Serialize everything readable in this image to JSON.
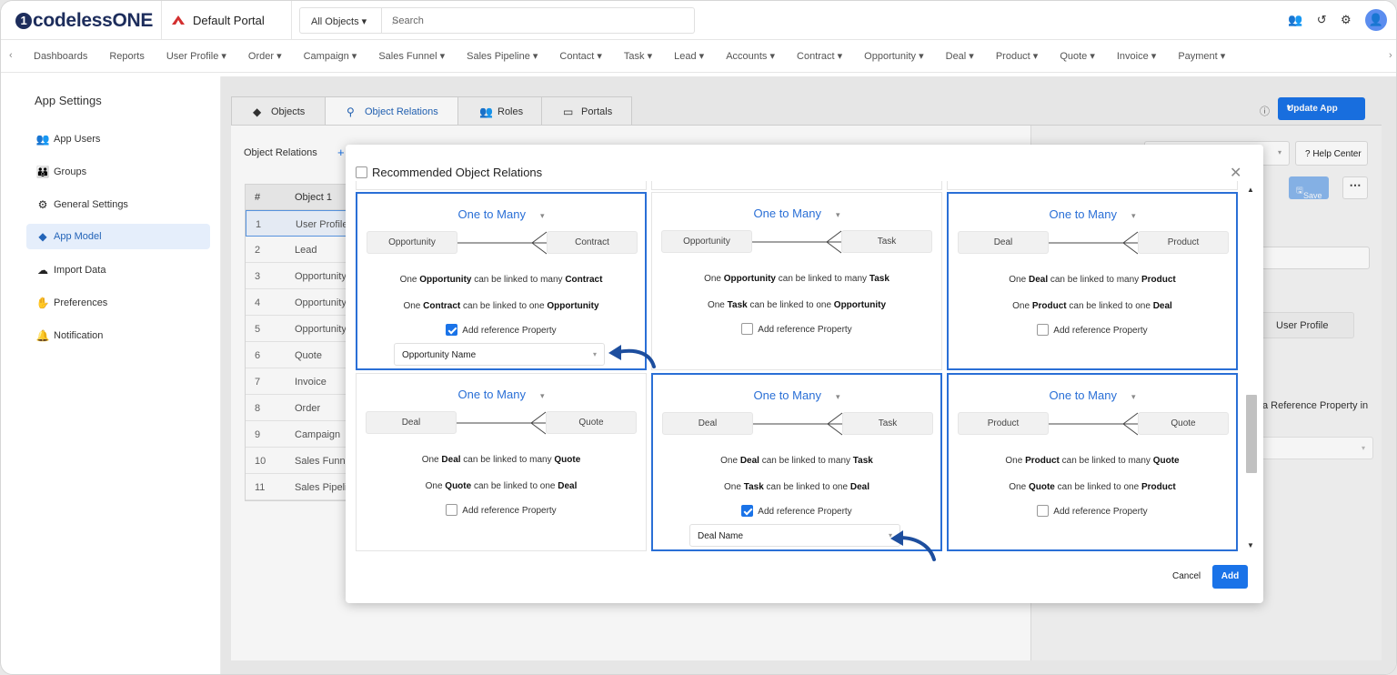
{
  "brand": {
    "logo_prefix": "1",
    "logo_main": "codeless",
    "logo_suffix": "ONE"
  },
  "header": {
    "portal_name": "Default Portal",
    "object_select": "All Objects",
    "search_placeholder": "Search"
  },
  "nav": {
    "items": [
      "Dashboards",
      "Reports",
      "User Profile ▾",
      "Order ▾",
      "Campaign ▾",
      "Sales Funnel ▾",
      "Sales Pipeline ▾",
      "Contact ▾",
      "Task ▾",
      "Lead ▾",
      "Accounts ▾",
      "Contract ▾",
      "Opportunity ▾",
      "Deal ▾",
      "Product ▾",
      "Quote ▾",
      "Invoice ▾",
      "Payment ▾"
    ]
  },
  "sidebar": {
    "title": "App Settings",
    "items": [
      {
        "label": "App Users",
        "icon": "users-icon"
      },
      {
        "label": "Groups",
        "icon": "groups-icon"
      },
      {
        "label": "General Settings",
        "icon": "gear-icon"
      },
      {
        "label": "App Model",
        "icon": "cube-icon"
      },
      {
        "label": "Import Data",
        "icon": "cloud-upload-icon"
      },
      {
        "label": "Preferences",
        "icon": "hand-heart-icon"
      },
      {
        "label": "Notification",
        "icon": "bell-icon"
      }
    ]
  },
  "tabs": [
    {
      "label": "Objects",
      "icon": "cube-icon"
    },
    {
      "label": "Object Relations",
      "icon": "relations-icon"
    },
    {
      "label": "Roles",
      "icon": "users-icon"
    },
    {
      "label": "Portals",
      "icon": "monitor-icon"
    }
  ],
  "toolbar": {
    "update_app": "Update App",
    "help_center": "? Help Center",
    "save": "Save"
  },
  "content": {
    "object_relations_label": "Object Relations",
    "table_headers": [
      "#",
      "Object 1"
    ],
    "rows": [
      {
        "n": "1",
        "object": "User Profile"
      },
      {
        "n": "2",
        "object": "Lead"
      },
      {
        "n": "3",
        "object": "Opportunity"
      },
      {
        "n": "4",
        "object": "Opportunity"
      },
      {
        "n": "5",
        "object": "Opportunity"
      },
      {
        "n": "6",
        "object": "Quote"
      },
      {
        "n": "7",
        "object": "Invoice"
      },
      {
        "n": "8",
        "object": "Order"
      },
      {
        "n": "9",
        "object": "Campaign"
      },
      {
        "n": "10",
        "object": "Sales Funnel"
      },
      {
        "n": "11",
        "object": "Sales Pipeline"
      }
    ]
  },
  "right_panel": {
    "user_profile_btn": "User Profile",
    "reference_text": "a Reference Property in"
  },
  "modal": {
    "title": "Recommended Object Relations",
    "cancel": "Cancel",
    "add": "Add",
    "cards": [
      {
        "type": "One to Many",
        "left": "Opportunity",
        "right": "Contract",
        "l1a": "One ",
        "l1b": "Opportunity",
        "l1c": " can be linked to many ",
        "l1d": "Contract",
        "l2a": "One ",
        "l2b": "Contract",
        "l2c": " can be linked to one ",
        "l2d": "Opportunity",
        "ref_label": "Add reference Property",
        "checked": true,
        "dropdown": "Opportunity Name",
        "selected": true
      },
      {
        "type": "One to Many",
        "left": "Opportunity",
        "right": "Task",
        "l1a": "One ",
        "l1b": "Opportunity",
        "l1c": " can be linked to many ",
        "l1d": "Task",
        "l2a": "One ",
        "l2b": "Task",
        "l2c": " can be linked to one ",
        "l2d": "Opportunity",
        "ref_label": "Add reference Property",
        "checked": false,
        "selected": false
      },
      {
        "type": "One to Many",
        "left": "Deal",
        "right": "Product",
        "l1a": "One ",
        "l1b": "Deal",
        "l1c": " can be linked to many ",
        "l1d": "Product",
        "l2a": "One ",
        "l2b": "Product",
        "l2c": " can be linked to one ",
        "l2d": "Deal",
        "ref_label": "Add reference Property",
        "checked": false,
        "selected": true
      },
      {
        "type": "One to Many",
        "left": "Deal",
        "right": "Quote",
        "l1a": "One ",
        "l1b": "Deal",
        "l1c": " can be linked to many ",
        "l1d": "Quote",
        "l2a": "One ",
        "l2b": "Quote",
        "l2c": " can be linked to one ",
        "l2d": "Deal",
        "ref_label": "Add reference Property",
        "checked": false,
        "selected": false
      },
      {
        "type": "One to Many",
        "left": "Deal",
        "right": "Task",
        "l1a": "One ",
        "l1b": "Deal",
        "l1c": " can be linked to many ",
        "l1d": "Task",
        "l2a": "One ",
        "l2b": "Task",
        "l2c": " can be linked to one ",
        "l2d": "Deal",
        "ref_label": "Add reference Property",
        "checked": true,
        "dropdown": "Deal Name",
        "selected": true
      },
      {
        "type": "One to Many",
        "left": "Product",
        "right": "Quote",
        "l1a": "One ",
        "l1b": "Product",
        "l1c": " can be linked to many ",
        "l1d": "Quote",
        "l2a": "One ",
        "l2b": "Quote",
        "l2c": " can be linked to one ",
        "l2d": "Product",
        "ref_label": "Add reference Property",
        "checked": false,
        "selected": true
      }
    ]
  },
  "colors": {
    "accent": "#1a73e8",
    "brand_dark": "#1d2d5c",
    "arrow": "#1d4e9e"
  }
}
